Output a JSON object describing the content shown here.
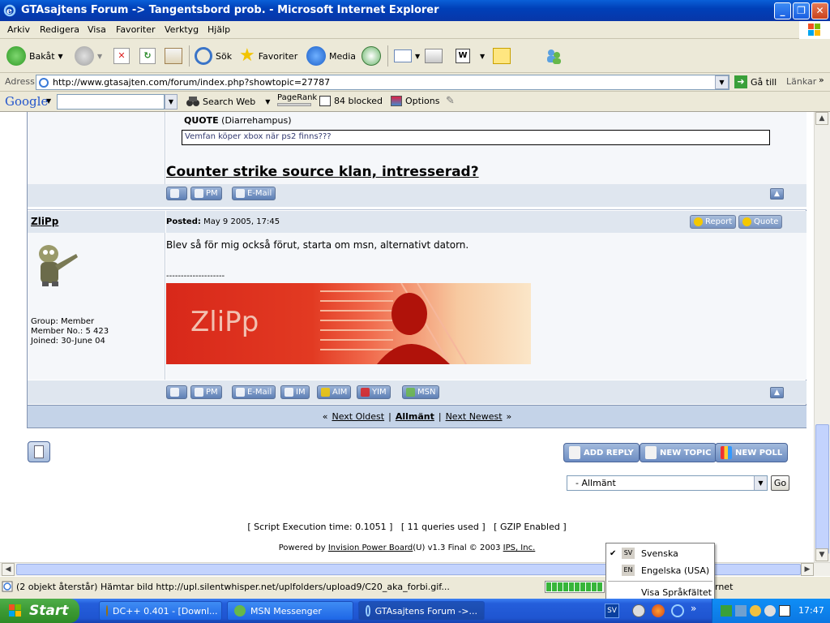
{
  "window": {
    "title": "GTAsajtens Forum -> Tangentsbord prob. - Microsoft Internet Explorer",
    "buttons": [
      "_",
      "❐",
      "✕"
    ]
  },
  "menu": [
    "Arkiv",
    "Redigera",
    "Visa",
    "Favoriter",
    "Verktyg",
    "Hjälp"
  ],
  "toolbar": {
    "back": "Bakåt",
    "search": "Sök",
    "favorites": "Favoriter",
    "media": "Media"
  },
  "address": {
    "label": "Adress",
    "url": "http://www.gtasajten.com/forum/index.php?showtopic=27787",
    "go": "Gå till",
    "links": "Länkar"
  },
  "google": {
    "logo": "Google",
    "search_web": "Search Web",
    "pagerank": "PageRank",
    "blocked": "84 blocked",
    "options": "Options"
  },
  "forum": {
    "quote_label": "QUOTE",
    "quote_author": "(Diarrehampus)",
    "quote_text": "Vemfan köper xbox när ps2 finns???",
    "signature_link": "Counter strike source klan, intresserad?",
    "btn_pm": "PM",
    "btn_email": "E-Mail",
    "btn_im": "IM",
    "btn_aim": "AIM",
    "btn_yim": "YIM",
    "btn_msn": "MSN",
    "btn_report": "Report",
    "btn_quote": "Quote",
    "author": "ZliPp",
    "posted_label": "Posted:",
    "posted_date": "May 9 2005, 17:45",
    "body": "Blev så för mig också förut, starta om msn, alternativt datorn.",
    "separator": "--------------------",
    "sig_image_text": "ZliPp",
    "group": "Group: Member",
    "member_no": "Member No.: 5 423",
    "joined": "Joined: 30-June 04",
    "nav_prev_marks": "«",
    "nav_oldest": "Next Oldest",
    "nav_sep": "|",
    "nav_current": "Allmänt",
    "nav_newest": "Next Newest",
    "nav_next_marks": "»",
    "add_reply": "ADD REPLY",
    "new_topic": "NEW TOPIC",
    "new_poll": "NEW POLL",
    "forum_select": "- Allmänt",
    "go_btn": "Go",
    "stats": "[ Script Execution time: 0.1051 ]   [ 11 queries used ]   [ GZIP Enabled ]",
    "powered_prefix": "Powered by",
    "powered_link": "Invision Power Board",
    "powered_mid": "(U) v1.3 Final © 2003",
    "ips_link": "IPS, Inc."
  },
  "lang_popup": {
    "items": [
      {
        "code": "SV",
        "label": "Svenska",
        "checked": true
      },
      {
        "code": "EN",
        "label": "Engelska (USA)",
        "checked": false
      }
    ],
    "show_bar": "Visa Språkfältet"
  },
  "status": {
    "text": "(2 objekt återstår) Hämtar bild http://upl.silentwhisper.net/uplfolders/upload9/C20_aka_forbi.gif...",
    "zone": "rnet"
  },
  "taskbar": {
    "start": "Start",
    "tasks": [
      "DC++ 0.401 - [Downl...",
      "MSN Messenger",
      "GTAsajtens Forum ->..."
    ],
    "lang": "SV",
    "clock": "17:47"
  }
}
